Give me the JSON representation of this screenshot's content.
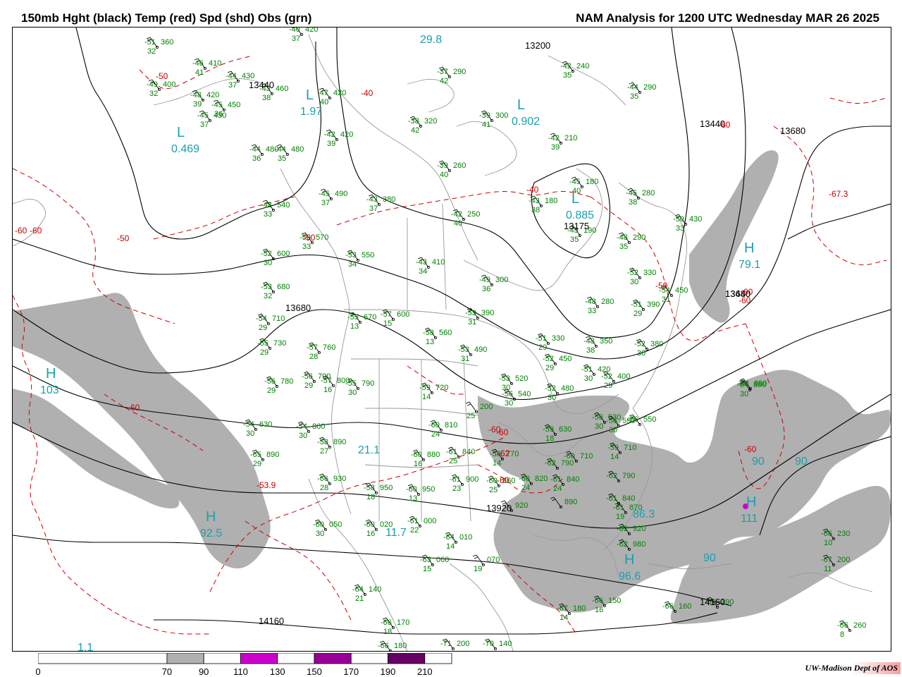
{
  "header": {
    "left_title": "150mb Hght (black) Temp (red) Spd (shd) Obs (grn)",
    "right_title": "NAM Analysis for 1200 UTC Wednesday  MAR 26 2025"
  },
  "credit": "UW-Madison  Dept of AOS",
  "colors": {
    "height_contour": "#000000",
    "temp_contour": "#cc0000",
    "speed_shade_70_90": "#b0b0b0",
    "speed_shade_110_130": "#cc00cc",
    "speed_shade_150_170": "#990099",
    "speed_shade_190_210": "#660066",
    "obs_text": "#008000",
    "center_label": "#1aa0b0",
    "geography": "#999999"
  },
  "legend": {
    "labels": [
      "0",
      "70",
      "90",
      "110",
      "130",
      "150",
      "170",
      "190",
      "210"
    ],
    "segments": [
      {
        "from": 0,
        "to": 70,
        "color": "#ffffff"
      },
      {
        "from": 70,
        "to": 90,
        "color": "#b0b0b0"
      },
      {
        "from": 90,
        "to": 110,
        "color": "#ffffff"
      },
      {
        "from": 110,
        "to": 130,
        "color": "#cc00cc"
      },
      {
        "from": 130,
        "to": 150,
        "color": "#ffffff"
      },
      {
        "from": 150,
        "to": 170,
        "color": "#990099"
      },
      {
        "from": 170,
        "to": 190,
        "color": "#ffffff"
      },
      {
        "from": 190,
        "to": 210,
        "color": "#660066"
      }
    ]
  },
  "height_labels": [
    "13200",
    "13440",
    "13440",
    "13680",
    "13680",
    "13680",
    "13440",
    "13175",
    "13920",
    "14160",
    "14160"
  ],
  "temp_labels": [
    "-50",
    "-40",
    "-40",
    "-50",
    "-60",
    "-60",
    "-50",
    "-50",
    "-60",
    "-60",
    "-67.3",
    "-60",
    "-62",
    "-60",
    "-53.9",
    "-60",
    "-60",
    "-60",
    "-60"
  ],
  "centers": [
    {
      "letter": "L",
      "value": "0.469"
    },
    {
      "letter": "L",
      "value": "1.97"
    },
    {
      "letter": "L",
      "value": "0.885"
    },
    {
      "letter": "L",
      "value": "0.902"
    },
    {
      "letter": "",
      "value": "29.8"
    },
    {
      "letter": "H",
      "value": "79.1"
    },
    {
      "letter": "H",
      "value": "103"
    },
    {
      "letter": "H",
      "value": "92.5"
    },
    {
      "letter": "H",
      "value": "96.6"
    },
    {
      "letter": "H",
      "value": "111"
    },
    {
      "letter": "",
      "value": "86.3"
    },
    {
      "letter": "",
      "value": "21.1"
    },
    {
      "letter": "",
      "value": "11.7"
    },
    {
      "letter": "",
      "value": "90"
    },
    {
      "letter": "",
      "value": "90"
    },
    {
      "letter": "",
      "value": "90"
    },
    {
      "letter": "",
      "value": "1.1"
    }
  ],
  "observations": [
    {
      "t": "-51",
      "d": "32",
      "h": "360"
    },
    {
      "t": "-46",
      "d": "41",
      "h": "410"
    },
    {
      "t": "-44",
      "d": "37",
      "h": "430"
    },
    {
      "t": "-49",
      "d": "32",
      "h": "400"
    },
    {
      "t": "-43",
      "d": "38",
      "h": "460"
    },
    {
      "t": "-48",
      "d": "39",
      "h": "420"
    },
    {
      "t": "-45",
      "d": "36",
      "h": "450"
    },
    {
      "t": "-45",
      "d": "37",
      "h": "430"
    },
    {
      "t": "-40",
      "d": "37",
      "h": "420"
    },
    {
      "t": "-47",
      "d": "40",
      "h": "420"
    },
    {
      "t": "-42",
      "d": "39",
      "h": "420"
    },
    {
      "t": "-38",
      "d": "42",
      "h": "320"
    },
    {
      "t": "-37",
      "d": "42",
      "h": "290"
    },
    {
      "t": "-39",
      "d": "41",
      "h": "300"
    },
    {
      "t": "-42",
      "d": "35",
      "h": "240"
    },
    {
      "t": "-44",
      "d": "35",
      "h": "290"
    },
    {
      "t": "-42",
      "d": "39",
      "h": "210"
    },
    {
      "t": "-44",
      "d": "36",
      "h": "480"
    },
    {
      "t": "-44",
      "d": "35",
      "h": "480"
    },
    {
      "t": "-39",
      "d": "40",
      "h": "260"
    },
    {
      "t": "-45",
      "d": "40",
      "h": "180"
    },
    {
      "t": "-43",
      "d": "38",
      "h": "180"
    },
    {
      "t": "-45",
      "d": "38",
      "h": "280"
    },
    {
      "t": "-45",
      "d": "37",
      "h": "490"
    },
    {
      "t": "-43",
      "d": "37",
      "h": "380"
    },
    {
      "t": "-48",
      "d": "33",
      "h": "540"
    },
    {
      "t": "-42",
      "d": "40",
      "h": "250"
    },
    {
      "t": "-45",
      "d": "35",
      "h": "190"
    },
    {
      "t": "-48",
      "d": "35",
      "h": "290"
    },
    {
      "t": "-50",
      "d": "33",
      "h": "430"
    },
    {
      "t": "-50",
      "d": "33",
      "h": "570"
    },
    {
      "t": "-53",
      "d": "34",
      "h": "550"
    },
    {
      "t": "-52",
      "d": "30",
      "h": "600"
    },
    {
      "t": "-43",
      "d": "34",
      "h": "410"
    },
    {
      "t": "-49",
      "d": "36",
      "h": "300"
    },
    {
      "t": "-52",
      "d": "30",
      "h": "330"
    },
    {
      "t": "-53",
      "d": "32",
      "h": "680"
    },
    {
      "t": "-48",
      "d": "33",
      "h": "280"
    },
    {
      "t": "-51",
      "d": "29",
      "h": "390"
    },
    {
      "t": "-54",
      "d": "31",
      "h": "450"
    },
    {
      "t": "-54",
      "d": "29",
      "h": "710"
    },
    {
      "t": "-55",
      "d": "13",
      "h": "670"
    },
    {
      "t": "-57",
      "d": "15",
      "h": "600"
    },
    {
      "t": "-53",
      "d": "31",
      "h": "390"
    },
    {
      "t": "-58",
      "d": "13",
      "h": "560"
    },
    {
      "t": "-55",
      "d": "29",
      "h": "730"
    },
    {
      "t": "-57",
      "d": "28",
      "h": "760"
    },
    {
      "t": "-53",
      "d": "31",
      "h": "490"
    },
    {
      "t": "-51",
      "d": "29",
      "h": "330"
    },
    {
      "t": "-48",
      "d": "38",
      "h": "350"
    },
    {
      "t": "-52",
      "d": "30",
      "h": "380"
    },
    {
      "t": "-52",
      "d": "29",
      "h": "450"
    },
    {
      "t": "-56",
      "d": "29",
      "h": "780"
    },
    {
      "t": "-56",
      "d": "29",
      "h": "790"
    },
    {
      "t": "-57",
      "d": "16",
      "h": "800"
    },
    {
      "t": "-55",
      "d": "30",
      "h": "790"
    },
    {
      "t": "-53",
      "d": "30",
      "h": "520"
    },
    {
      "t": "-51",
      "d": "30",
      "h": "420"
    },
    {
      "t": "-52",
      "d": "29",
      "h": "400"
    },
    {
      "t": "-59",
      "d": "14",
      "h": "720"
    },
    {
      "t": "-56",
      "d": "30",
      "h": "540"
    },
    {
      "t": "-52",
      "d": "30",
      "h": "480"
    },
    {
      "t": "-64",
      "d": "",
      "h": "880"
    },
    {
      "t": "-54",
      "d": "30",
      "h": "630"
    },
    {
      "t": "-54",
      "d": "30",
      "h": "860"
    },
    {
      "t": "-58",
      "d": "27",
      "h": "890"
    },
    {
      "t": "",
      "d": "25",
      "h": "200"
    },
    {
      "t": "-60",
      "d": "24",
      "h": "810"
    },
    {
      "t": "-59",
      "d": "18",
      "h": "630"
    },
    {
      "t": "-56",
      "d": "30",
      "h": "530"
    },
    {
      "t": "-56",
      "d": "30",
      "h": "590"
    },
    {
      "t": "-56",
      "d": "",
      "h": "550"
    },
    {
      "t": "-61",
      "d": "25",
      "h": "840"
    },
    {
      "t": "-58",
      "d": "14",
      "h": "770"
    },
    {
      "t": "-60",
      "d": "16",
      "h": "880"
    },
    {
      "t": "-62",
      "d": "",
      "h": "790"
    },
    {
      "t": "-60",
      "d": "",
      "h": "710"
    },
    {
      "t": "-59",
      "d": "14",
      "h": "710"
    },
    {
      "t": "-65",
      "d": "29",
      "h": "890"
    },
    {
      "t": "-66",
      "d": "28",
      "h": "930"
    },
    {
      "t": "-58",
      "d": "18",
      "h": "950"
    },
    {
      "t": "-60",
      "d": "13",
      "h": "950"
    },
    {
      "t": "-61",
      "d": "23",
      "h": "900"
    },
    {
      "t": "-60",
      "d": "25",
      "h": "860"
    },
    {
      "t": "-60",
      "d": "24",
      "h": "820"
    },
    {
      "t": "-61",
      "d": "24",
      "h": "840"
    },
    {
      "t": "-62",
      "d": "",
      "h": "790"
    },
    {
      "t": "-61",
      "d": "",
      "h": "840"
    },
    {
      "t": "-60",
      "d": "30",
      "h": "050"
    },
    {
      "t": "-60",
      "d": "16",
      "h": "020"
    },
    {
      "t": "-61",
      "d": "22",
      "h": "000"
    },
    {
      "t": "",
      "d": "",
      "h": "920"
    },
    {
      "t": "",
      "d": "",
      "h": "890"
    },
    {
      "t": "-62",
      "d": "",
      "h": "920"
    },
    {
      "t": "-62",
      "d": "",
      "h": "980"
    },
    {
      "t": "-61",
      "d": "19",
      "h": "870"
    },
    {
      "t": "-64",
      "d": "14",
      "h": "010"
    },
    {
      "t": "-63",
      "d": "15",
      "h": "060"
    },
    {
      "t": "",
      "d": "19",
      "h": "070"
    },
    {
      "t": "-64",
      "d": "21",
      "h": "140"
    },
    {
      "t": "-67",
      "d": "14",
      "h": "180"
    },
    {
      "t": "-66",
      "d": "16",
      "h": "150"
    },
    {
      "t": "-66",
      "d": "18",
      "h": "170"
    },
    {
      "t": "-66",
      "d": "",
      "h": "180"
    },
    {
      "t": "-71",
      "d": "",
      "h": "200"
    },
    {
      "t": "-70",
      "d": "",
      "h": "140"
    },
    {
      "t": "-66",
      "d": "",
      "h": "160"
    },
    {
      "t": "-67",
      "d": "",
      "h": "190"
    },
    {
      "t": "-66",
      "d": "10",
      "h": "230"
    },
    {
      "t": "-67",
      "d": "11",
      "h": "200"
    },
    {
      "t": "-66",
      "d": "8",
      "h": "260"
    },
    {
      "t": "-64",
      "d": "30",
      "h": "880"
    }
  ]
}
